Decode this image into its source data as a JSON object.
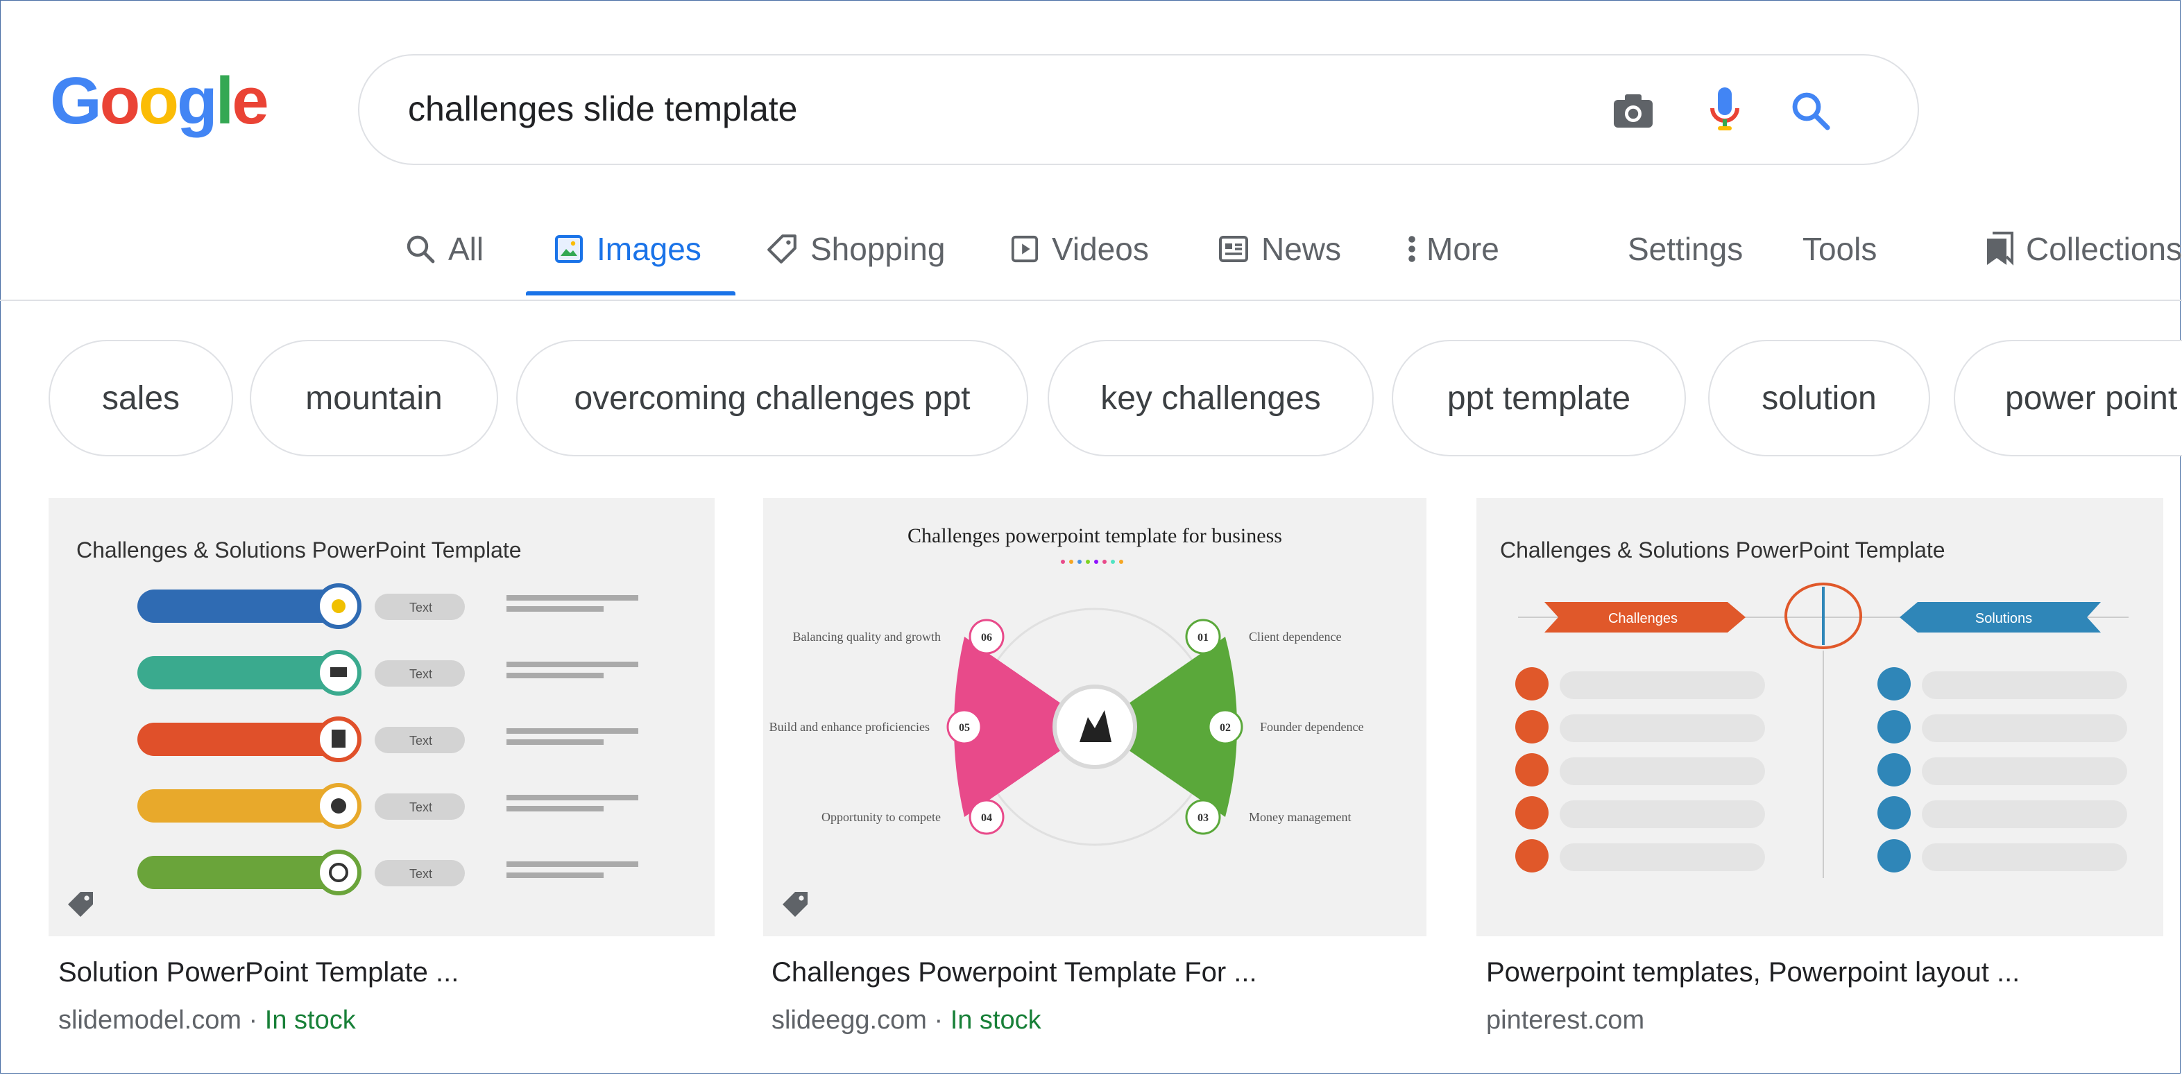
{
  "logo": {
    "letters": [
      "G",
      "o",
      "o",
      "g",
      "l",
      "e"
    ],
    "colors": [
      "#4285F4",
      "#EA4335",
      "#FBBC05",
      "#4285F4",
      "#34A853",
      "#EA4335"
    ]
  },
  "search": {
    "query": "challenges slide template",
    "icons": [
      "camera-icon",
      "mic-icon",
      "search-icon"
    ]
  },
  "tabs": [
    {
      "label": "All",
      "icon": "search-icon",
      "active": false
    },
    {
      "label": "Images",
      "icon": "image-icon",
      "active": true
    },
    {
      "label": "Shopping",
      "icon": "tag-icon",
      "active": false
    },
    {
      "label": "Videos",
      "icon": "play-icon",
      "active": false
    },
    {
      "label": "News",
      "icon": "news-icon",
      "active": false
    },
    {
      "label": "More",
      "icon": "more-vert-icon",
      "active": false
    }
  ],
  "tools": {
    "settings": "Settings",
    "tools": "Tools",
    "collections": "Collections"
  },
  "chips": [
    "sales",
    "mountain",
    "overcoming challenges ppt",
    "key challenges",
    "ppt template",
    "solution",
    "power point"
  ],
  "results": [
    {
      "title": "Solution PowerPoint Template ...",
      "site": "slidemodel.com",
      "separator": " · ",
      "stock": "In stock",
      "slide_heading": "Challenges & Solutions PowerPoint Template",
      "slide_label": "Text"
    },
    {
      "title": "Challenges Powerpoint Template For ...",
      "site": "slideegg.com",
      "separator": " · ",
      "stock": "In stock",
      "slide_heading": "Challenges powerpoint template for business",
      "slide_items": [
        {
          "num": "06",
          "text": "Balancing quality and growth"
        },
        {
          "num": "05",
          "text": "Build and enhance proficiencies"
        },
        {
          "num": "04",
          "text": "Opportunity to compete"
        },
        {
          "num": "01",
          "text": "Client dependence"
        },
        {
          "num": "02",
          "text": "Founder dependence"
        },
        {
          "num": "03",
          "text": "Money management"
        }
      ]
    },
    {
      "title": "Powerpoint templates, Powerpoint layout ...",
      "site": "pinterest.com",
      "separator": "",
      "stock": "",
      "slide_heading": "Challenges & Solutions PowerPoint Template",
      "slide_left_label": "Challenges",
      "slide_right_label": "Solutions"
    }
  ]
}
